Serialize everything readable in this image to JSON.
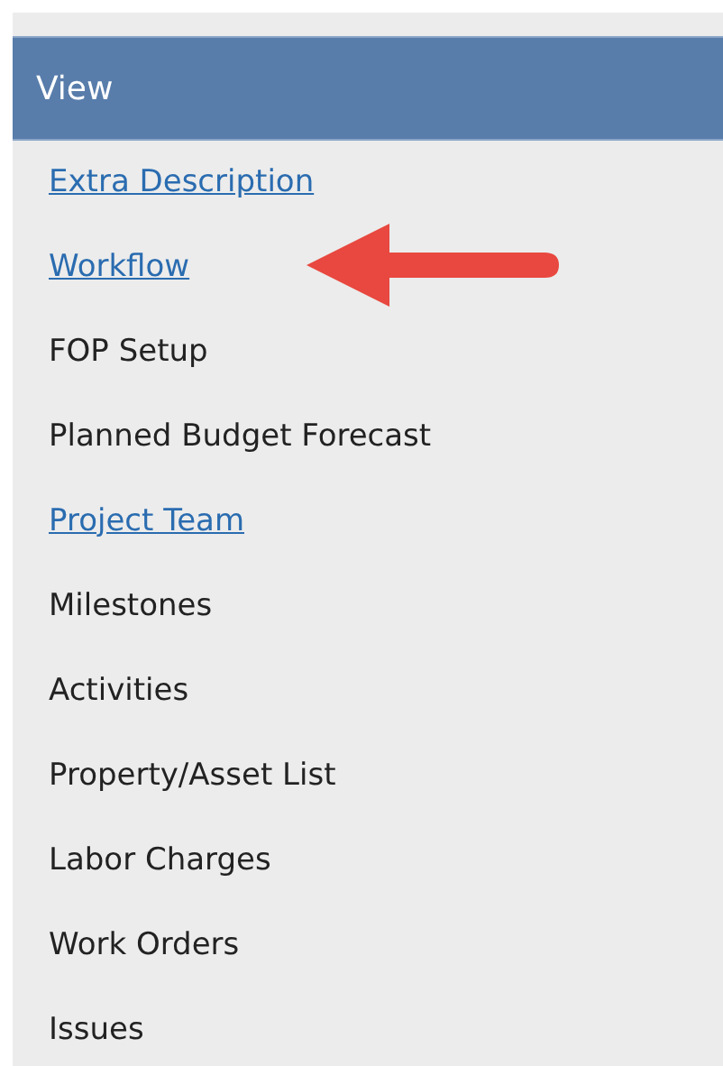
{
  "panel": {
    "title": "View",
    "items": [
      {
        "label": "Extra Description",
        "kind": "link"
      },
      {
        "label": "Workflow",
        "kind": "link"
      },
      {
        "label": "FOP Setup",
        "kind": "text"
      },
      {
        "label": "Planned Budget Forecast",
        "kind": "text"
      },
      {
        "label": "Project Team",
        "kind": "link"
      },
      {
        "label": "Milestones",
        "kind": "text"
      },
      {
        "label": "Activities",
        "kind": "text"
      },
      {
        "label": "Property/Asset List",
        "kind": "text"
      },
      {
        "label": "Labor Charges",
        "kind": "text"
      },
      {
        "label": "Work Orders",
        "kind": "text"
      },
      {
        "label": "Issues",
        "kind": "text"
      }
    ]
  }
}
